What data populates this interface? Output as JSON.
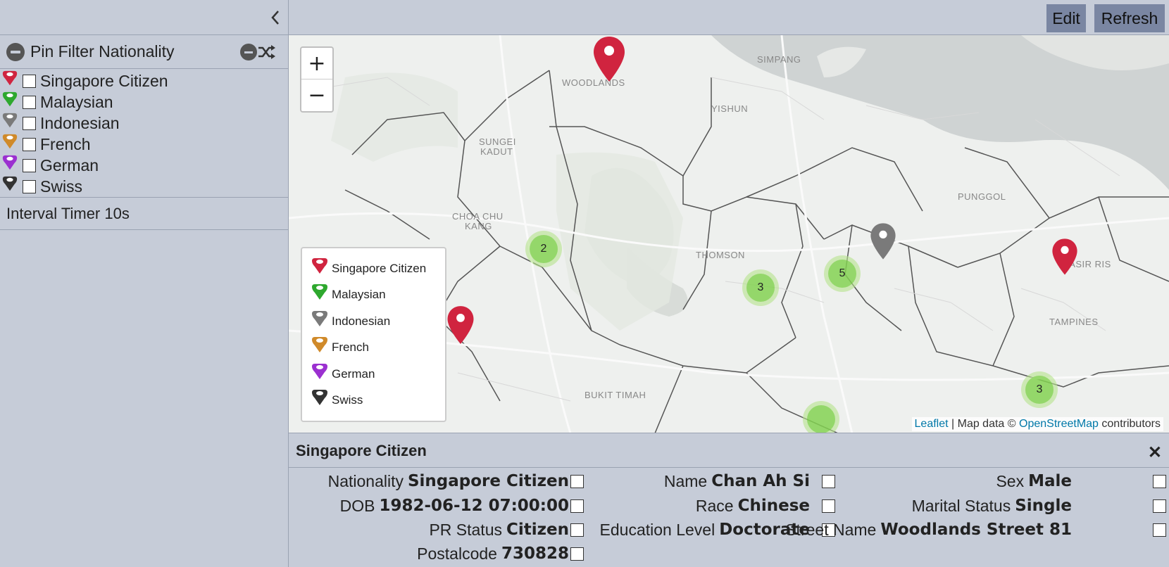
{
  "sidebar": {
    "filter_title": "Pin Filter Nationality",
    "items": [
      {
        "label": "Singapore Citizen",
        "color": "#d0243f"
      },
      {
        "label": "Malaysian",
        "color": "#2ea82e"
      },
      {
        "label": "Indonesian",
        "color": "#7a7a7a"
      },
      {
        "label": "French",
        "color": "#d08a2a"
      },
      {
        "label": "German",
        "color": "#9b30d0"
      },
      {
        "label": "Swiss",
        "color": "#333333"
      }
    ],
    "timer_label": "Interval Timer 10s"
  },
  "toolbar": {
    "edit_label": "Edit",
    "refresh_label": "Refresh"
  },
  "map": {
    "zoom_in": "+",
    "zoom_out": "−",
    "legend": [
      {
        "label": "Singapore Citizen",
        "color": "#d0243f"
      },
      {
        "label": "Malaysian",
        "color": "#2ea82e"
      },
      {
        "label": "Indonesian",
        "color": "#7a7a7a"
      },
      {
        "label": "French",
        "color": "#d08a2a"
      },
      {
        "label": "German",
        "color": "#9b30d0"
      },
      {
        "label": "Swiss",
        "color": "#333333"
      }
    ],
    "attribution": {
      "leaflet": "Leaflet",
      "sep": " | Map data © ",
      "osm": "OpenStreetMap",
      "contrib": " contributors"
    },
    "place_labels": {
      "woodlands": "WOODLANDS",
      "simpang": "SIMPANG",
      "yishun": "YISHUN",
      "sungei_kadut_1": "SUNGEI",
      "sungei_kadut_2": "KADUT",
      "punggol": "PUNGGOL",
      "choa_chu_kang_1": "CHOA CHU",
      "choa_chu_kang_2": "KANG",
      "thomson": "THOMSON",
      "pasir_ris": "PASIR RIS",
      "tampines": "TAMPINES",
      "bukit_timah": "BUKIT TIMAH"
    },
    "clusters": [
      {
        "count": "2"
      },
      {
        "count": "3"
      },
      {
        "count": "5"
      },
      {
        "count": "3"
      }
    ]
  },
  "detail": {
    "title": "Singapore Citizen",
    "close": "✕",
    "fields": {
      "nationality": {
        "key": "Nationality",
        "value": "Singapore Citizen"
      },
      "name": {
        "key": "Name",
        "value": "Chan Ah Si"
      },
      "sex": {
        "key": "Sex",
        "value": "Male"
      },
      "dob": {
        "key": "DOB",
        "value": "1982-06-12 07:00:00"
      },
      "race": {
        "key": "Race",
        "value": "Chinese"
      },
      "marital": {
        "key": "Marital Status",
        "value": "Single"
      },
      "pr_status": {
        "key": "PR Status",
        "value": "Citizen"
      },
      "education": {
        "key": "Education Level",
        "value": "Doctorate"
      },
      "street": {
        "key": "Street Name",
        "value": "Woodlands Street 81"
      },
      "postal": {
        "key": "Postalcode",
        "value": "730828"
      }
    }
  }
}
